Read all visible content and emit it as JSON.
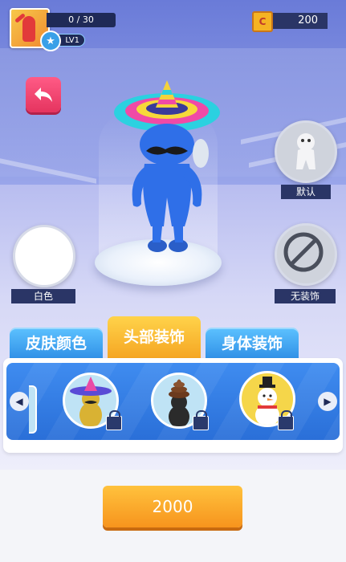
{
  "player": {
    "xp": "0 / 30",
    "level": "LV1"
  },
  "currency": {
    "coins": "200"
  },
  "side": {
    "default_label": "默认",
    "white_label": "白色",
    "none_label": "无装饰"
  },
  "tabs": [
    {
      "label": "皮肤颜色"
    },
    {
      "label": "头部装饰"
    },
    {
      "label": "身体装饰"
    }
  ],
  "buy": {
    "price": "2000"
  },
  "colors": {
    "accent": "#f5a623",
    "tab_blue": "#2f8fe6",
    "character": "#2f6fe8",
    "back": "#e5345f"
  }
}
